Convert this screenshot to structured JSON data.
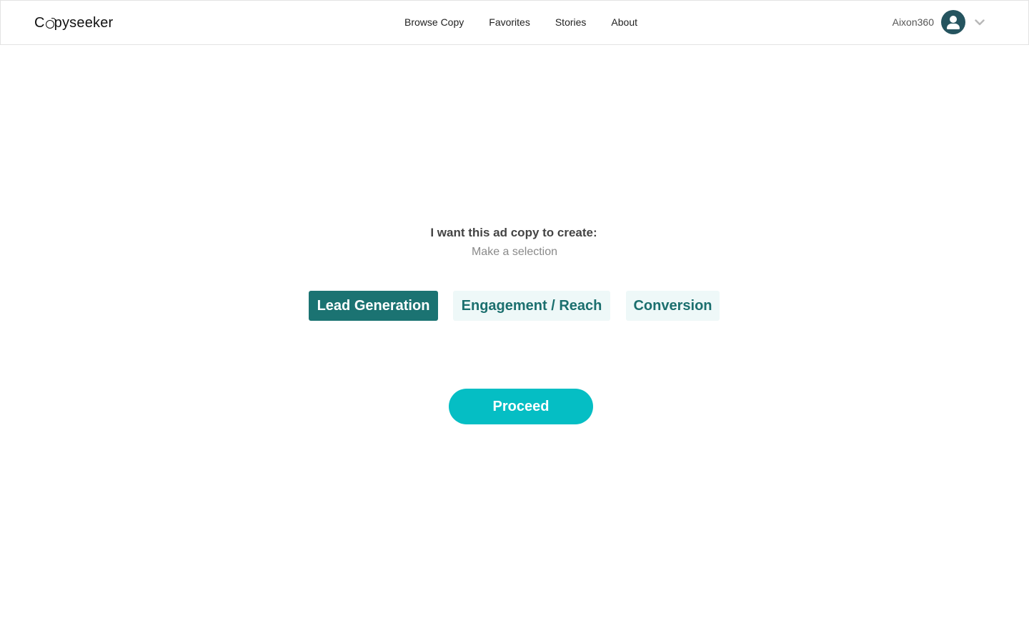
{
  "brand": {
    "logo_prefix": "C",
    "logo_suffix": "pyseeker",
    "logo_full": "Copyseeker"
  },
  "nav": {
    "items": [
      {
        "label": "Browse Copy"
      },
      {
        "label": "Favorites"
      },
      {
        "label": "Stories"
      },
      {
        "label": "About"
      }
    ]
  },
  "user": {
    "name": "Aixon360",
    "avatar_icon": "user-icon",
    "menu_icon": "chevron-down-icon"
  },
  "main": {
    "heading": "I want this ad copy to create:",
    "subheading": "Make a selection",
    "options": [
      {
        "label": "Lead Generation",
        "selected": true
      },
      {
        "label": "Engagement / Reach",
        "selected": false
      },
      {
        "label": "Conversion",
        "selected": false
      }
    ],
    "proceed_label": "Proceed"
  },
  "colors": {
    "selected_option_bg": "#1b7372",
    "unselected_option_bg": "#eef8f8",
    "unselected_option_text": "#1b6f6e",
    "proceed_bg": "#05bec4",
    "avatar_bg": "#25545f"
  }
}
